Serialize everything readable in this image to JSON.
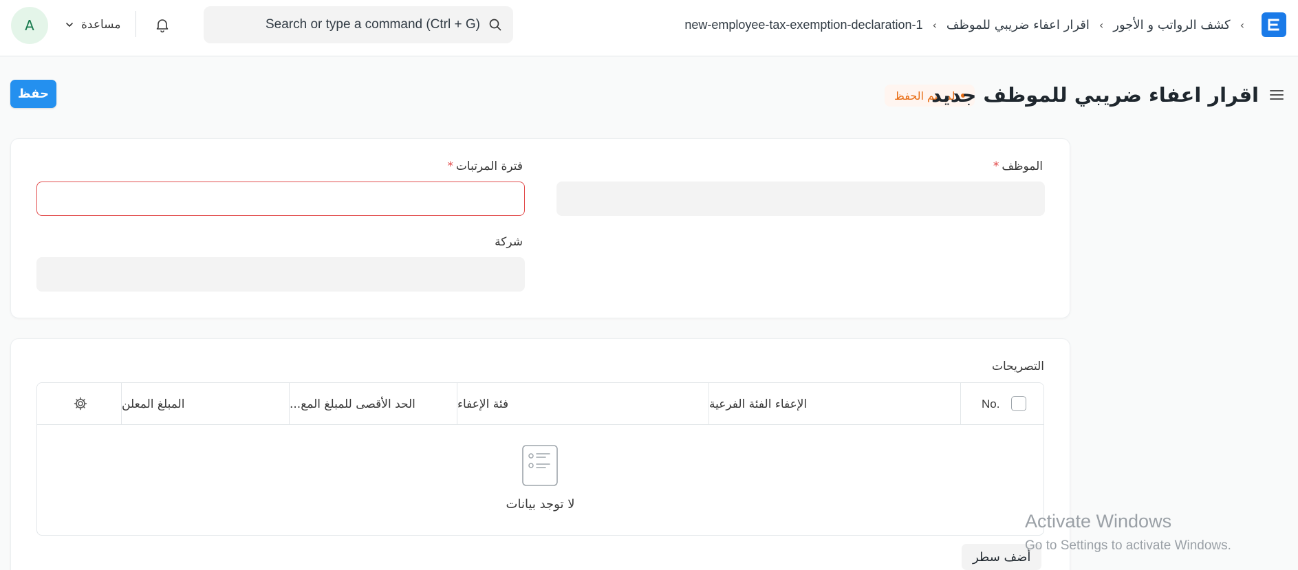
{
  "navbar": {
    "avatar_initial": "A",
    "help_label": "مساعدة",
    "search": {
      "placeholder": "Search or type a command (Ctrl + G)"
    },
    "breadcrumbs": [
      "كشف الرواتب و الأجور",
      "اقرار اعفاء ضريبي للموظف",
      "new-employee-tax-exemption-declaration-1"
    ],
    "breadcrumb_separator": "›",
    "logo_letter": "E",
    "brand_color": "#1a7ae8"
  },
  "page": {
    "title": "اقرار اعفاء ضريبي للموظف جديد",
    "status": "لم يتم الحفظ",
    "save_label": "حفظ",
    "accent_color": "#2490ef",
    "status_color": "#e86c13"
  },
  "form": {
    "employee_label": "الموظف",
    "payroll_period_label": "فترة المرتبات",
    "company_label": "شركة",
    "required_marker": "*",
    "error_color": "#e24c4c"
  },
  "declarations": {
    "section_label": "التصريحات",
    "columns": [
      "No.",
      "الإعفاء الفئة الفرعية",
      "فئة الإعفاء",
      "الحد الأقصى للمبلغ المع...",
      "المبلغ المعلن"
    ],
    "empty_text": "لا توجد بيانات",
    "add_row_label": "أضف سطر"
  },
  "watermark": {
    "title": "Activate Windows",
    "subtitle": "Go to Settings to activate Windows."
  }
}
